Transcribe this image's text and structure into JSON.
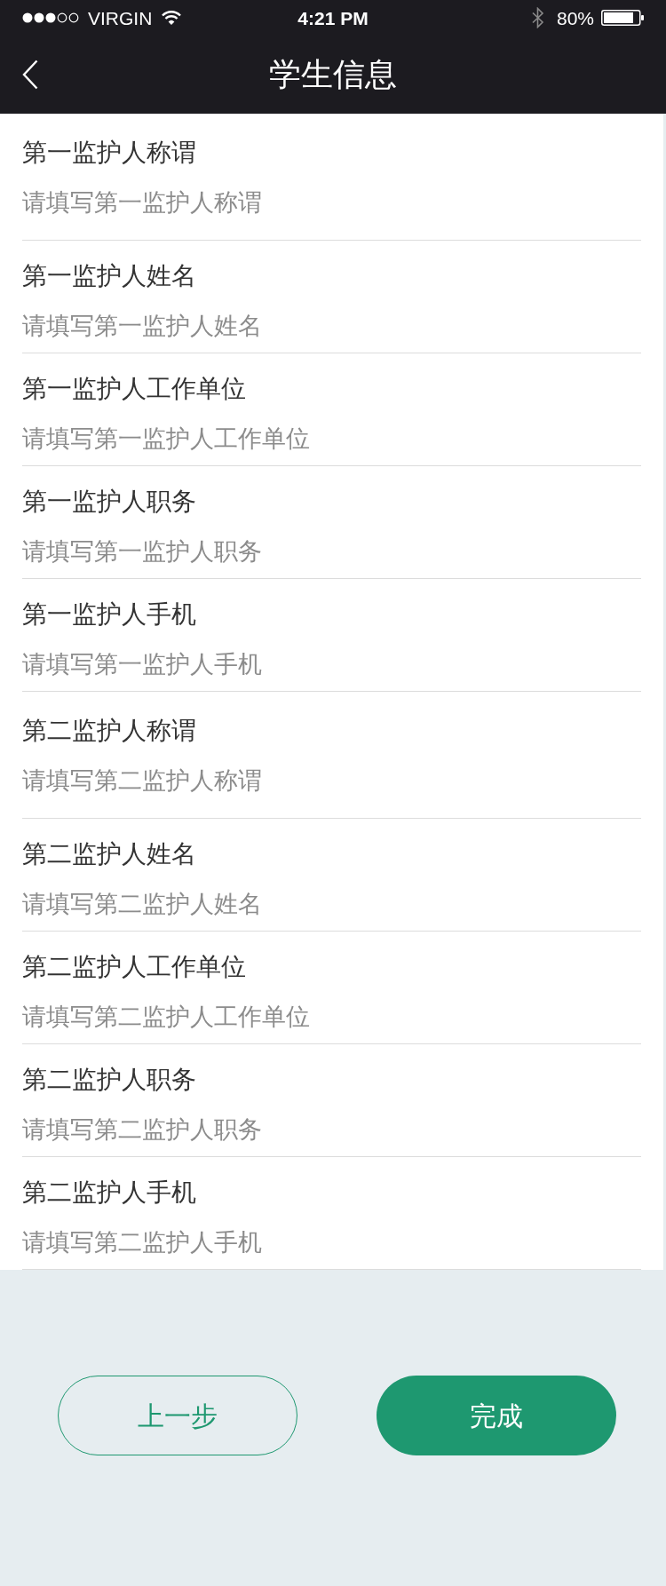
{
  "status_bar": {
    "carrier": "VIRGIN",
    "time": "4:21 PM",
    "battery": "80%"
  },
  "nav_bar": {
    "title": "学生信息"
  },
  "fields": [
    {
      "label": "第一监护人称谓",
      "placeholder": "请填写第一监护人称谓"
    },
    {
      "label": "第一监护人姓名",
      "placeholder": "请填写第一监护人姓名"
    },
    {
      "label": "第一监护人工作单位",
      "placeholder": "请填写第一监护人工作单位"
    },
    {
      "label": "第一监护人职务",
      "placeholder": "请填写第一监护人职务"
    },
    {
      "label": "第一监护人手机",
      "placeholder": "请填写第一监护人手机"
    },
    {
      "label": "第二监护人称谓",
      "placeholder": "请填写第二监护人称谓"
    },
    {
      "label": "第二监护人姓名",
      "placeholder": "请填写第二监护人姓名"
    },
    {
      "label": "第二监护人工作单位",
      "placeholder": "请填写第二监护人工作单位"
    },
    {
      "label": "第二监护人职务",
      "placeholder": "请填写第二监护人职务"
    },
    {
      "label": "第二监护人手机",
      "placeholder": "请填写第二监护人手机"
    }
  ],
  "buttons": [
    {
      "label": "上一步",
      "kind": "outline"
    },
    {
      "label": "完成",
      "kind": "primary"
    }
  ]
}
